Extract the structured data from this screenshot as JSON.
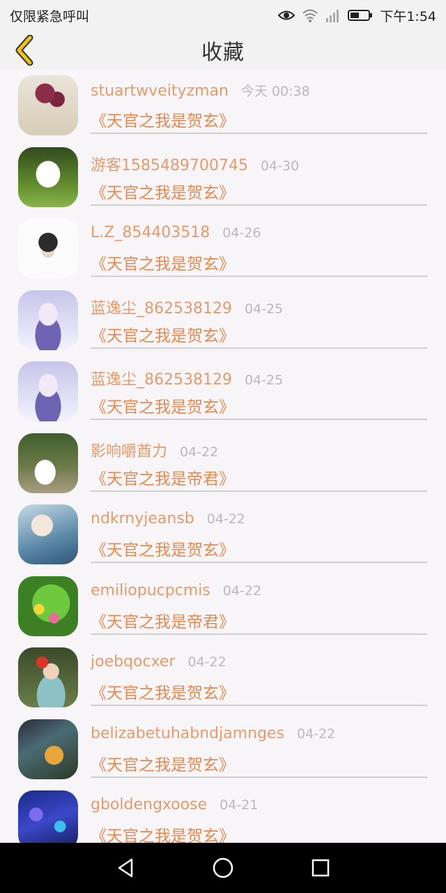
{
  "status_bar": {
    "left_text": "仅限紧急呼叫",
    "time": "下午1:54",
    "icons": [
      "eye-icon",
      "wifi-icon",
      "signal-icon",
      "battery-icon"
    ]
  },
  "header": {
    "title": "收藏",
    "back_icon": "chevron-left-icon"
  },
  "colors": {
    "accent": "#e7894f",
    "username": "#e79a6b",
    "time": "#b9b9b9",
    "back_icon": "#e0b000"
  },
  "favorites": [
    {
      "username": "stuartwveityzman",
      "time": "今天 00:38",
      "book": "《天官之我是贺玄》",
      "avatar": "roses-in-vase"
    },
    {
      "username": "游客1585489700745",
      "time": "04-30",
      "book": "《天官之我是贺玄》",
      "avatar": "white-dog-on-grass"
    },
    {
      "username": "L.Z_854403518",
      "time": "04-26",
      "book": "《天官之我是贺玄》",
      "avatar": "chibi-character"
    },
    {
      "username": "蓝逸尘_862538129",
      "time": "04-25",
      "book": "《天官之我是贺玄》",
      "avatar": "anime-girl-purple"
    },
    {
      "username": "蓝逸尘_862538129",
      "time": "04-25",
      "book": "《天官之我是贺玄》",
      "avatar": "anime-girl-purple"
    },
    {
      "username": "影响嚼酋力",
      "time": "04-22",
      "book": "《天官之我是帝君》",
      "avatar": "wedding-couple"
    },
    {
      "username": "ndkrnyjeansb",
      "time": "04-22",
      "book": "《天官之我是贺玄》",
      "avatar": "girl-blue-light"
    },
    {
      "username": "emiliopucpcmis",
      "time": "04-22",
      "book": "《天官之我是帝君》",
      "avatar": "green-hose-flowers"
    },
    {
      "username": "joebqocxer",
      "time": "04-22",
      "book": "《天官之我是贺玄》",
      "avatar": "child-with-flower"
    },
    {
      "username": "belizabetuhabndjamnges",
      "time": "04-22",
      "book": "《天官之我是贺玄》",
      "avatar": "forest-fantasy"
    },
    {
      "username": "gboldengxoose",
      "time": "04-21",
      "book": "《天官之我是贺玄》",
      "avatar": "blue-bokeh"
    }
  ],
  "nav_bar": {
    "buttons": [
      "back-triangle-icon",
      "home-circle-icon",
      "recents-square-icon"
    ]
  }
}
